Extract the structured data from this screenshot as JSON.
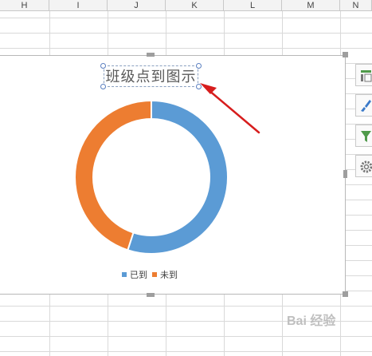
{
  "spreadsheet": {
    "columns": [
      "H",
      "I",
      "J",
      "K",
      "L",
      "M",
      "N"
    ]
  },
  "chart": {
    "title": "班级点到图示",
    "legend": [
      "已到",
      "未到"
    ]
  },
  "chart_data": {
    "type": "pie",
    "title": "班级点到图示",
    "categories": [
      "已到",
      "未到"
    ],
    "values": [
      55,
      45
    ],
    "colors": [
      "#5b9bd5",
      "#ed7d31"
    ],
    "style": "doughnut",
    "legend_position": "bottom"
  },
  "side_toolbar": {
    "icons": [
      "chart-elements-icon",
      "chart-style-icon",
      "chart-filter-icon",
      "settings-icon"
    ]
  },
  "colors": {
    "annotation_arrow": "#d71d1d",
    "selection_handle": "#9e9e9e",
    "title_handle_border": "#5a7fc0"
  },
  "watermark": {
    "text": "Bai 经验"
  }
}
